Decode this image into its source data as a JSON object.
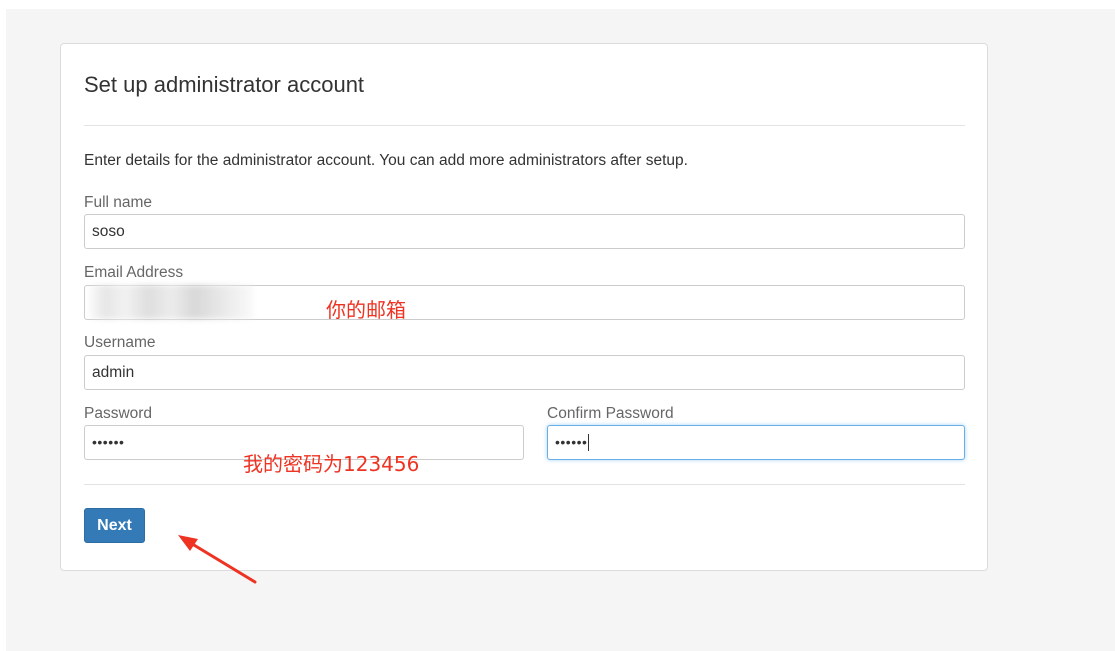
{
  "panel": {
    "title": "Set up administrator account",
    "description": "Enter details for the administrator account. You can add more administrators after setup."
  },
  "form": {
    "full_name": {
      "label": "Full name",
      "value": "soso"
    },
    "email": {
      "label": "Email Address",
      "value": ""
    },
    "username": {
      "label": "Username",
      "value": "admin"
    },
    "password": {
      "label": "Password",
      "value": "••••••"
    },
    "confirm_password": {
      "label": "Confirm Password",
      "value": "••••••"
    }
  },
  "actions": {
    "next_label": "Next"
  },
  "annotations": {
    "email_note": "你的邮箱",
    "password_note": "我的密码为123456"
  },
  "colors": {
    "primary_button": "#337ab7",
    "focus_border": "#66afe9",
    "annotation": "#ee3322",
    "page_background": "#f5f5f5"
  }
}
